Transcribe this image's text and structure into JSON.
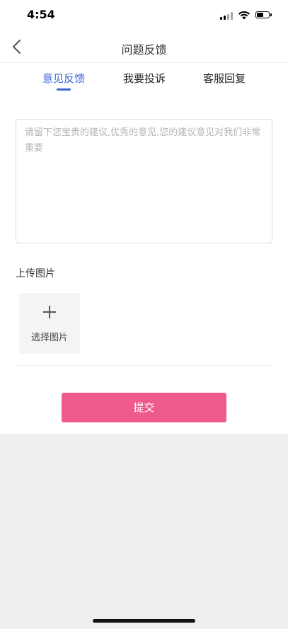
{
  "status_bar": {
    "time": "4:54"
  },
  "nav": {
    "title": "问题反馈"
  },
  "tabs": [
    {
      "label": "意见反馈",
      "active": true
    },
    {
      "label": "我要投诉",
      "active": false
    },
    {
      "label": "客服回复",
      "active": false
    }
  ],
  "feedback": {
    "placeholder": "请留下您宝贵的建议,优秀的意见,您的建议意见对我们非常重要",
    "value": ""
  },
  "upload": {
    "label": "上传图片",
    "tile_text": "选择图片"
  },
  "submit": {
    "label": "提交"
  },
  "colors": {
    "accent": "#3a64d8",
    "submit": "#ef5a8e",
    "background": "#efefef"
  },
  "icons": [
    "back-arrow-icon",
    "plus-icon",
    "signal-icon",
    "wifi-icon",
    "battery-icon"
  ]
}
